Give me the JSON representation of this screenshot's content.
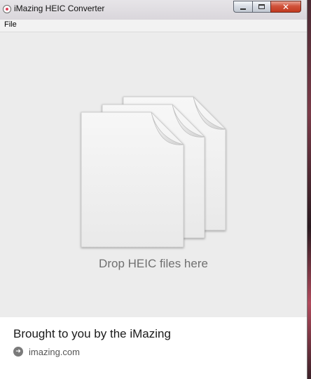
{
  "window": {
    "title": "iMazing HEIC Converter",
    "controls": {
      "minimize": "minimize",
      "maximize": "maximize",
      "close": "✕"
    }
  },
  "menubar": {
    "items": [
      {
        "label": "File"
      }
    ]
  },
  "drop_zone": {
    "instruction": "Drop HEIC files here",
    "icon": "stacked-documents-icon"
  },
  "footer": {
    "title": "Brought to you by the iMazing",
    "link": {
      "icon": "arrow-circle-icon",
      "text": "imazing.com"
    }
  },
  "colors": {
    "window_bg": "#ececec",
    "footer_bg": "#ffffff",
    "instruction_text": "#707070",
    "close_button": "#c8442a"
  }
}
